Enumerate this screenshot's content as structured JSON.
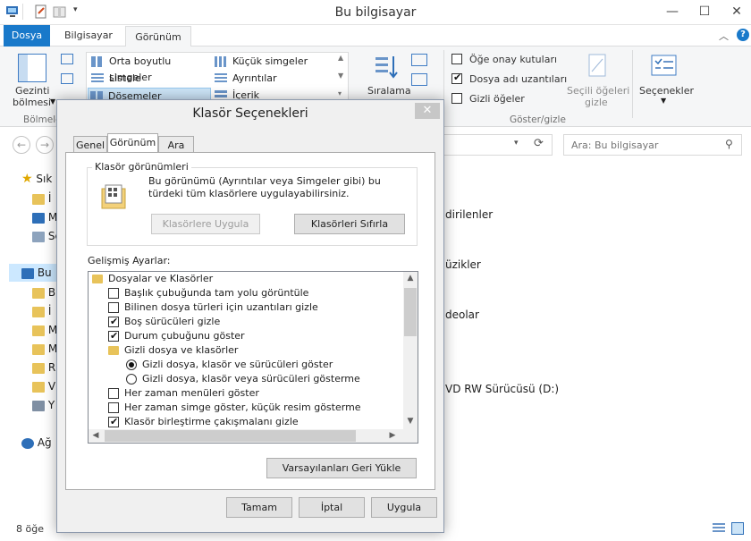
{
  "window": {
    "title": "Bu bilgisayar",
    "controls": [
      "minimize-icon",
      "maximize-icon",
      "close-icon"
    ]
  },
  "ribbon": {
    "tabs": [
      {
        "label": "Dosya"
      },
      {
        "label": "Bilgisayar"
      },
      {
        "label": "Görünüm"
      }
    ],
    "nav_pane": {
      "label1": "Gezinti",
      "label2": "bölmesi",
      "group": "Bölmeler"
    },
    "layouts": {
      "col1": [
        "Orta boyutlu simgeler",
        "Listele",
        "Döşemeler"
      ],
      "col2": [
        "Küçük simgeler",
        "Ayrıntılar",
        "İçerik"
      ]
    },
    "sort": {
      "label": "Sıralama"
    },
    "show_hide": {
      "items": [
        {
          "label": "Öğe onay kutuları",
          "checked": false
        },
        {
          "label": "Dosya adı uzantıları",
          "checked": true
        },
        {
          "label": "Gizli öğeler",
          "checked": false
        }
      ],
      "hide_selected_line1": "Seçili öğeleri",
      "hide_selected_line2": "gizle",
      "group": "Göster/gizle"
    },
    "options": {
      "label": "Seçenekler"
    }
  },
  "navigation": {
    "search_placeholder": "Ara: Bu bilgisayar"
  },
  "sidebar": {
    "items": [
      {
        "label": "Sık",
        "icon": "star-icon"
      },
      {
        "label": "İ",
        "icon": "downloads-folder-icon"
      },
      {
        "label": "M",
        "icon": "desktop-icon"
      },
      {
        "label": "Sc",
        "icon": "recent-places-icon"
      },
      {
        "label": "Bu",
        "icon": "computer-icon"
      },
      {
        "label": "B",
        "icon": "folder-icon"
      },
      {
        "label": "İ",
        "icon": "downloads-folder-icon"
      },
      {
        "label": "M",
        "icon": "folder-icon"
      },
      {
        "label": "M",
        "icon": "music-folder-icon"
      },
      {
        "label": "R",
        "icon": "pictures-folder-icon"
      },
      {
        "label": "V",
        "icon": "videos-folder-icon"
      },
      {
        "label": "Y",
        "icon": "drive-icon"
      },
      {
        "label": "Ağ",
        "icon": "network-icon"
      }
    ]
  },
  "main": {
    "items": [
      "dirilenler",
      "üzikler",
      "deolar",
      "VD RW Sürücüsü (D:)"
    ]
  },
  "status": {
    "count": "8 öğe"
  },
  "dialog": {
    "title": "Klasör Seçenekleri",
    "tabs": [
      "Genel",
      "Görünüm",
      "Ara"
    ],
    "folder_views": {
      "title": "Klasör görünümleri",
      "description": "Bu görünümü (Ayrıntılar veya Simgeler gibi) bu türdeki tüm klasörlere uygulayabilirsiniz.",
      "apply_button": "Klasörlere Uygula",
      "reset_button": "Klasörleri Sıfırla"
    },
    "advanced": {
      "title": "Gelişmiş Ayarlar:",
      "rows": [
        {
          "type": "folder",
          "label": "Dosyalar ve Klasörler",
          "indent": 0
        },
        {
          "type": "checkbox",
          "label": "Başlık çubuğunda tam yolu görüntüle",
          "checked": false,
          "indent": 1
        },
        {
          "type": "checkbox",
          "label": "Bilinen dosya türleri için uzantıları gizle",
          "checked": false,
          "indent": 1
        },
        {
          "type": "checkbox",
          "label": "Boş sürücüleri gizle",
          "checked": true,
          "indent": 1
        },
        {
          "type": "checkbox",
          "label": "Durum çubuğunu göster",
          "checked": true,
          "indent": 1
        },
        {
          "type": "folder",
          "label": "Gizli dosya ve klasörler",
          "indent": 1
        },
        {
          "type": "radio",
          "label": "Gizli dosya, klasör ve sürücüleri göster",
          "checked": true,
          "indent": 2
        },
        {
          "type": "radio",
          "label": "Gizli dosya, klasör veya sürücüleri gösterme",
          "checked": false,
          "indent": 2
        },
        {
          "type": "checkbox",
          "label": "Her zaman menüleri göster",
          "checked": false,
          "indent": 1
        },
        {
          "type": "checkbox",
          "label": "Her zaman simge göster, küçük resim gösterme",
          "checked": false,
          "indent": 1
        },
        {
          "type": "checkbox",
          "label": "Klasör birleştirme çakışmalanı gizle",
          "checked": true,
          "indent": 1
        }
      ]
    },
    "restore_defaults": "Varsayılanları Geri Yükle",
    "ok": "Tamam",
    "cancel": "İptal",
    "apply": "Uygula"
  }
}
